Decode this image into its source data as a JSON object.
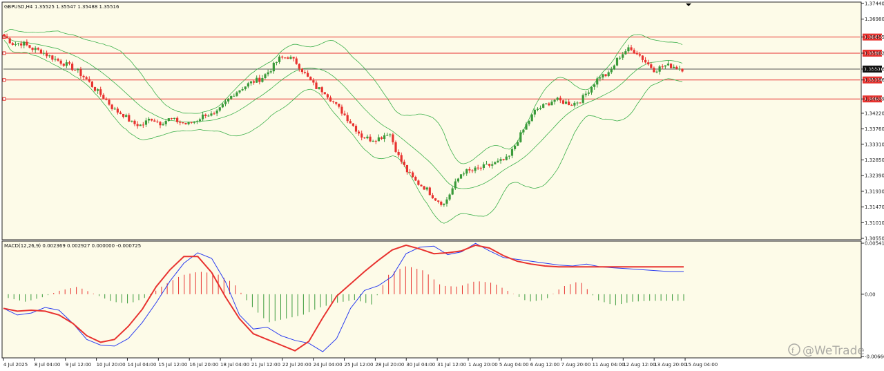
{
  "chart_data": [
    {
      "type": "candlestick",
      "title": "GBPUSD,H4",
      "ohlc_header": "1.35525 1.35547 1.35488 1.35516",
      "ylim": [
        1.3055,
        1.3744
      ],
      "y_ticks": [
        "1.37440",
        "1.36980",
        "1.36455",
        "1.35982",
        "1.35516",
        "1.35196",
        "1.34639",
        "1.34220",
        "1.33760",
        "1.33310",
        "1.32850",
        "1.32390",
        "1.31930",
        "1.31470",
        "1.31010",
        "1.30550"
      ],
      "x_labels": [
        "4 Jul 2025",
        "8 Jul 04:00",
        "9 Jul 12:00",
        "10 Jul 20:00",
        "14 Jul 04:00",
        "15 Jul 12:00",
        "16 Jul 20:00",
        "18 Jul 04:00",
        "21 Jul 12:00",
        "22 Jul 20:00",
        "24 Jul 04:00",
        "25 Jul 12:00",
        "28 Jul 20:00",
        "30 Jul 04:00",
        "31 Jul 12:00",
        "1 Aug 20:00",
        "5 Aug 04:00",
        "6 Aug 12:00",
        "7 Aug 20:00",
        "11 Aug 04:00",
        "12 Aug 12:00",
        "13 Aug 20:00",
        "15 Aug 04:00"
      ],
      "current_price": 1.35516,
      "horizontal_levels": [
        {
          "value": 1.36455,
          "label": "1.36455",
          "color": "#e8322f"
        },
        {
          "value": 1.35982,
          "label": "1.35982",
          "color": "#e8322f"
        },
        {
          "value": 1.35196,
          "label": "1.35196",
          "color": "#e8322f"
        },
        {
          "value": 1.34639,
          "label": "1.34639",
          "color": "#e8322f"
        }
      ],
      "close_path": [
        1.3648,
        1.3625,
        1.3628,
        1.3612,
        1.3604,
        1.3588,
        1.3575,
        1.3562,
        1.3545,
        1.3521,
        1.349,
        1.3465,
        1.3432,
        1.3418,
        1.3392,
        1.3386,
        1.3408,
        1.3393,
        1.3405,
        1.3398,
        1.3389,
        1.3402,
        1.342,
        1.3415,
        1.3448,
        1.3479,
        1.3497,
        1.3513,
        1.3523,
        1.3548,
        1.3582,
        1.3588,
        1.3568,
        1.353,
        1.3498,
        1.3485,
        1.3451,
        1.3422,
        1.3388,
        1.3355,
        1.3345,
        1.335,
        1.3368,
        1.3297,
        1.325,
        1.3219,
        1.3202,
        1.3172,
        1.3155,
        1.3205,
        1.3251,
        1.3252,
        1.3262,
        1.327,
        1.3279,
        1.3289,
        1.3342,
        1.3389,
        1.3432,
        1.3445,
        1.3462,
        1.3455,
        1.3449,
        1.3462,
        1.3498,
        1.3531,
        1.3536,
        1.3585,
        1.361,
        1.3602,
        1.3572,
        1.3548,
        1.3562,
        1.356,
        1.3552
      ],
      "bollinger": {
        "period": 20,
        "deviations": 2,
        "color": "#3cb04a"
      },
      "bull_color": "#3a9a3a",
      "bear_color": "#e8322f"
    },
    {
      "type": "line",
      "title": "MACD(12,26,9) 0.002369 0.002927 0.000000 -0.000725",
      "ylim": [
        -0.006609,
        0.005416
      ],
      "y_ticks": [
        "0.005416",
        "0.00",
        "-0.006609"
      ],
      "series": [
        {
          "name": "MACD",
          "color": "#2a3cf0",
          "values": [
            -0.0015,
            -0.0022,
            -0.002,
            -0.0014,
            -0.0017,
            -0.0031,
            -0.0048,
            -0.0054,
            -0.0055,
            -0.0047,
            -0.003,
            -0.0009,
            0.0014,
            0.0033,
            0.0044,
            0.0038,
            0.0013,
            -0.0022,
            -0.0037,
            -0.0035,
            -0.0044,
            -0.0049,
            -0.0052,
            -0.0061,
            -0.0047,
            -0.0015,
            0.0004,
            0.0009,
            0.0019,
            0.0043,
            0.005,
            0.0051,
            0.0042,
            0.0045,
            0.0054,
            0.0046,
            0.0039,
            0.0037,
            0.0035,
            0.0033,
            0.0031,
            0.003,
            0.0032,
            0.0029,
            0.0028,
            0.0027,
            0.0026,
            0.0025,
            0.0024,
            0.0024
          ]
        },
        {
          "name": "Signal",
          "color": "#e8322f",
          "values": [
            -0.0015,
            -0.0018,
            -0.0017,
            -0.0018,
            -0.0022,
            -0.0031,
            -0.0044,
            -0.0051,
            -0.0048,
            -0.0034,
            -0.0016,
            0.0008,
            0.0026,
            0.004,
            0.004,
            0.0023,
            -0.0003,
            -0.0026,
            -0.0042,
            -0.0048,
            -0.0054,
            -0.006,
            -0.005,
            -0.0025,
            -0.0002,
            0.0011,
            0.0024,
            0.0036,
            0.0047,
            0.0052,
            0.0048,
            0.0043,
            0.0044,
            0.0046,
            0.0052,
            0.0049,
            0.0041,
            0.0035,
            0.0032,
            0.003,
            0.0029,
            0.0029,
            0.0029,
            0.0029,
            0.0029,
            0.0029,
            0.0029,
            0.0029,
            0.0029,
            0.0029
          ]
        }
      ],
      "histogram": {
        "values": [
          -0.0004,
          -0.0008,
          -0.0003,
          0.0004,
          0.0008,
          0.0,
          -0.0008,
          -0.001,
          -0.0003,
          0.001,
          0.002,
          0.0024,
          0.0022,
          0.0012,
          -0.0012,
          -0.003,
          -0.0026,
          -0.0022,
          -0.0014,
          -0.0009,
          -0.0006,
          -0.0011,
          0.0022,
          0.003,
          0.0025,
          0.0009,
          0.0008,
          0.0014,
          0.0012,
          0.0002,
          -0.0008,
          -0.0006,
          0.0008,
          0.0014,
          -0.0006,
          -0.0012,
          -0.0008,
          -0.0007,
          -0.0007,
          -0.0007
        ],
        "pos_color": "#e8322f",
        "neg_color": "#3a9a3a"
      }
    }
  ],
  "watermark": "@WeTrade"
}
